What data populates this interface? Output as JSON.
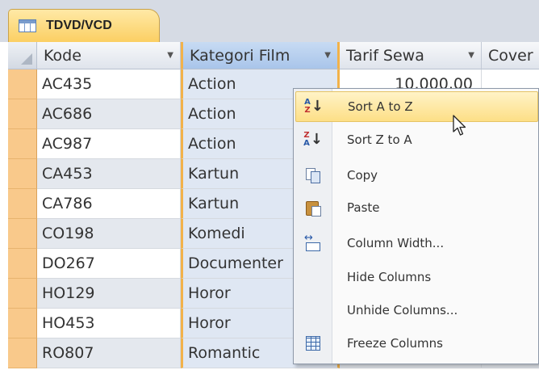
{
  "tab": {
    "title": "TDVD/VCD",
    "icon": "table-icon"
  },
  "columns": {
    "kode": "Kode",
    "kategori": "Kategori Film",
    "tarif": "Tarif Sewa",
    "cover": "Cover"
  },
  "rows": [
    {
      "kode": "AC435",
      "kategori": "Action",
      "tarif": "10.000,00"
    },
    {
      "kode": "AC686",
      "kategori": "Action",
      "tarif": ""
    },
    {
      "kode": "AC987",
      "kategori": "Action",
      "tarif": ""
    },
    {
      "kode": "CA453",
      "kategori": "Kartun",
      "tarif": ""
    },
    {
      "kode": "CA786",
      "kategori": "Kartun",
      "tarif": ""
    },
    {
      "kode": "CO198",
      "kategori": "Komedi",
      "tarif": ""
    },
    {
      "kode": "DO267",
      "kategori": "Documenter",
      "tarif": ""
    },
    {
      "kode": "HO129",
      "kategori": "Horor",
      "tarif": ""
    },
    {
      "kode": "HO453",
      "kategori": "Horor",
      "tarif": ""
    },
    {
      "kode": "RO807",
      "kategori": "Romantic",
      "tarif": ""
    }
  ],
  "context_menu": {
    "items": [
      {
        "label": "Sort A to Z",
        "icon": "sort-a-to-z-icon",
        "highlighted": true
      },
      {
        "label": "Sort Z to A",
        "icon": "sort-z-to-a-icon"
      },
      {
        "label": "Copy",
        "icon": "copy-icon"
      },
      {
        "label": "Paste",
        "icon": "paste-icon"
      },
      {
        "label": "Column Width...",
        "icon": "column-width-icon"
      },
      {
        "label": "Hide Columns",
        "icon": ""
      },
      {
        "label": "Unhide Columns...",
        "icon": ""
      },
      {
        "label": "Freeze Columns",
        "icon": "freeze-columns-icon"
      }
    ]
  },
  "colors": {
    "tab_active": "#fbcf63",
    "record_selector": "#f9c98b",
    "selected_column": "#dfe7f3",
    "menu_highlight": "#fddf86"
  }
}
